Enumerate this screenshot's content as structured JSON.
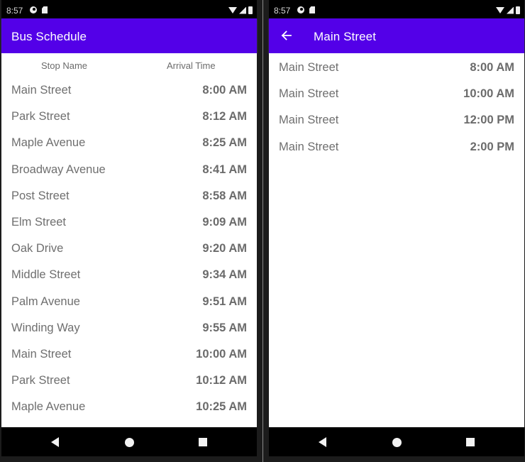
{
  "status_bar": {
    "time": "8:57"
  },
  "left_screen": {
    "app_bar": {
      "title": "Bus Schedule"
    },
    "table": {
      "headers": {
        "stop_name": "Stop Name",
        "arrival_time": "Arrival Time"
      },
      "rows": [
        {
          "stop": "Main Street",
          "time": "8:00 AM"
        },
        {
          "stop": "Park Street",
          "time": "8:12 AM"
        },
        {
          "stop": "Maple Avenue",
          "time": "8:25 AM"
        },
        {
          "stop": "Broadway Avenue",
          "time": "8:41 AM"
        },
        {
          "stop": "Post Street",
          "time": "8:58 AM"
        },
        {
          "stop": "Elm Street",
          "time": "9:09 AM"
        },
        {
          "stop": "Oak Drive",
          "time": "9:20 AM"
        },
        {
          "stop": "Middle Street",
          "time": "9:34 AM"
        },
        {
          "stop": "Palm Avenue",
          "time": "9:51 AM"
        },
        {
          "stop": "Winding Way",
          "time": "9:55 AM"
        },
        {
          "stop": "Main Street",
          "time": "10:00 AM"
        },
        {
          "stop": "Park Street",
          "time": "10:12 AM"
        },
        {
          "stop": "Maple Avenue",
          "time": "10:25 AM"
        }
      ]
    }
  },
  "right_screen": {
    "app_bar": {
      "title": "Main Street",
      "back_icon": "arrow-back-icon"
    },
    "rows": [
      {
        "stop": "Main Street",
        "time": "8:00 AM"
      },
      {
        "stop": "Main Street",
        "time": "10:00 AM"
      },
      {
        "stop": "Main Street",
        "time": "12:00 PM"
      },
      {
        "stop": "Main Street",
        "time": "2:00 PM"
      }
    ]
  },
  "colors": {
    "app_bar": "#5300e8",
    "text_gray": "#6f6f6f"
  }
}
